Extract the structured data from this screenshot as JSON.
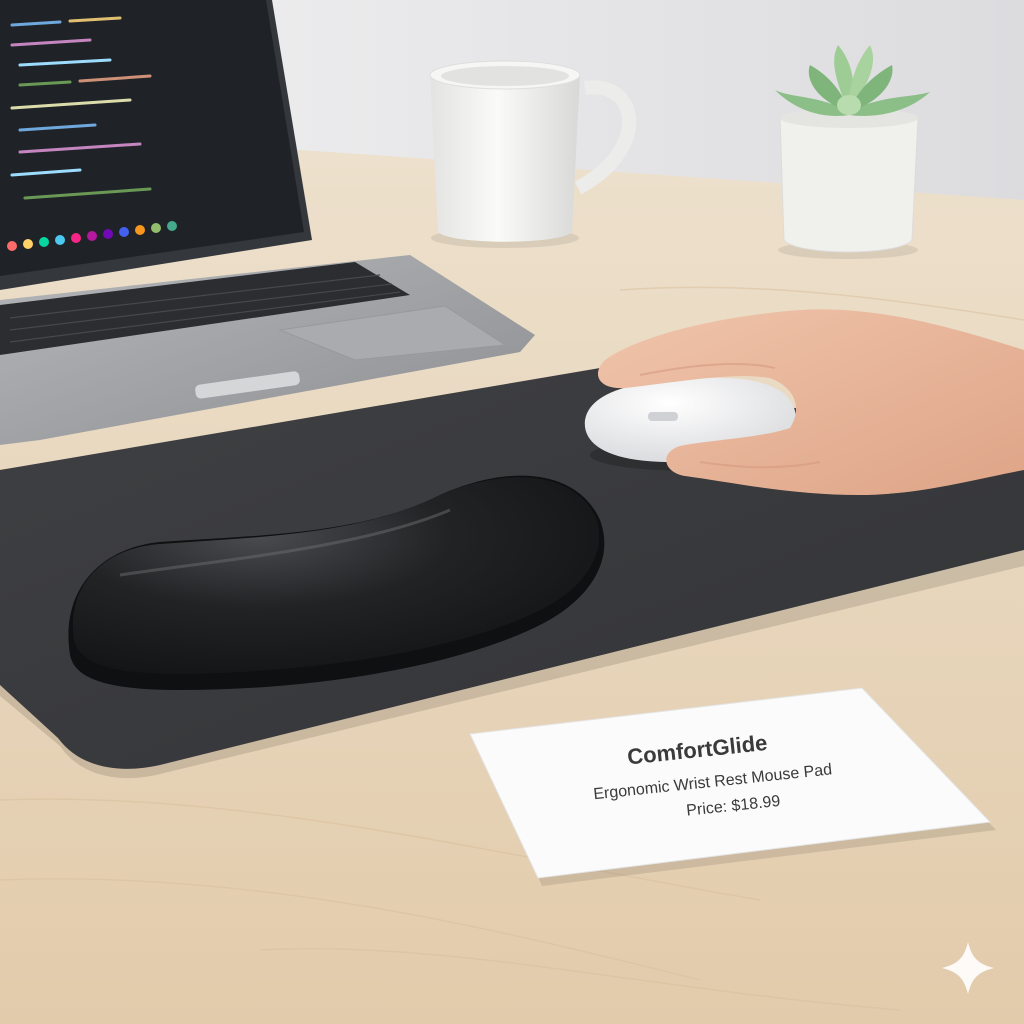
{
  "scene": {
    "description_label": "desk-with-ergonomic-mouse-pad",
    "colors": {
      "wall": "#e9e9ea",
      "desk": "#e6d2b5",
      "mouse_pad": "#3b3c3e",
      "wrist_rest": "#1e1f21",
      "mug": "#f2f2f0",
      "pot": "#efefec",
      "succulent": "#8fbf8a",
      "laptop_body": "#9c9ea1",
      "laptop_screen": "#22262c",
      "mouse": "#ecedef",
      "skin": "#e9b69a",
      "card": "#fbfbfb"
    },
    "icons": {
      "sparkle": "sparkle-icon"
    }
  },
  "product_card": {
    "brand": "ComfortGlide",
    "product": "Ergonomic Wrist Rest Mouse Pad",
    "price": "Price: $18.99"
  }
}
